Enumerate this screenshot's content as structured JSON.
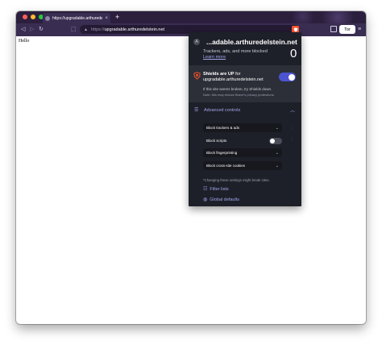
{
  "window": {
    "traffic_lights": [
      "#ff5f57",
      "#febc2e",
      "#28c840"
    ]
  },
  "tab": {
    "title": "https://upgradable.arthuredelstein.net",
    "close": "×",
    "new_tab": "+"
  },
  "toolbar": {
    "back": "◁",
    "forward": "▷",
    "reload": "↻",
    "bookmark": "⬚",
    "url_scheme": "https://",
    "url_host": "upgradable.arthuredelstein.net",
    "tor_label": "Tor",
    "menu": "≡"
  },
  "page": {
    "body_text": "Hello"
  },
  "panel": {
    "site_initial": "A",
    "site_name": "...adable.arthuredelstein.net",
    "blocked_label": "Trackers, ads, and more blocked",
    "learn_more": "Learn more",
    "blocked_count": "0",
    "shields_status_prefix": "Shields are UP",
    "shields_status_suffix": "for",
    "shields_host": "upgradable.arthuredelstein.net",
    "shields_enabled": true,
    "broken_text": "If this site seems broken, try Shields down.",
    "reduce_note": "Note: this may reduce Brave's privacy protections",
    "advanced_label": "Advanced controls",
    "controls": {
      "trackers": "Block trackers & ads",
      "scripts": "Block scripts",
      "scripts_enabled": false,
      "fingerprinting": "Block fingerprinting",
      "cookies": "Block cross-site cookies"
    },
    "settings_note": "*Changing these settings might break sites.",
    "filter_lists": "Filter lists",
    "global_defaults": "Global defaults",
    "colors": {
      "accent": "#a0a5eb",
      "toggle_on": "#4c54d2",
      "brave_orange": "#fb542b"
    }
  }
}
